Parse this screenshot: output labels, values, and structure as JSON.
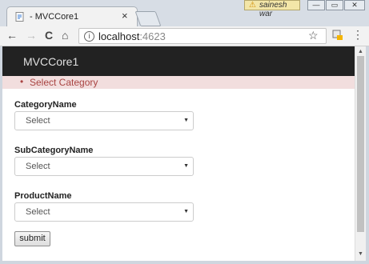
{
  "browser": {
    "tab_title": "- MVCCore1",
    "tab_close": "×",
    "user_name": "sainesh war",
    "url_host": "localhost",
    "url_port": ":4623",
    "nav_back": "←",
    "nav_forward": "→",
    "nav_reload": "C",
    "nav_home": "⌂",
    "star": "☆",
    "menu": "⋮",
    "info": "i",
    "window_minimize": "—",
    "window_restore": "▭",
    "window_close": "✕"
  },
  "page": {
    "brand": "MVCCore1",
    "validation_messages": [
      "Select Category"
    ],
    "fields": [
      {
        "label": "CategoryName",
        "value": "Select"
      },
      {
        "label": "SubCategoryName",
        "value": "Select"
      },
      {
        "label": "ProductName",
        "value": "Select"
      }
    ],
    "submit_label": "submit"
  },
  "colors": {
    "navbar": "#222222",
    "validation_bg": "#f2dede",
    "validation_text": "#a94442"
  },
  "icons": {
    "back": "arrow-left-icon",
    "forward": "arrow-right-icon",
    "reload": "reload-icon",
    "home": "home-icon",
    "info": "info-icon",
    "star": "star-icon",
    "extension": "extension-icon",
    "menu": "kebab-menu-icon",
    "warning": "warning-icon"
  }
}
